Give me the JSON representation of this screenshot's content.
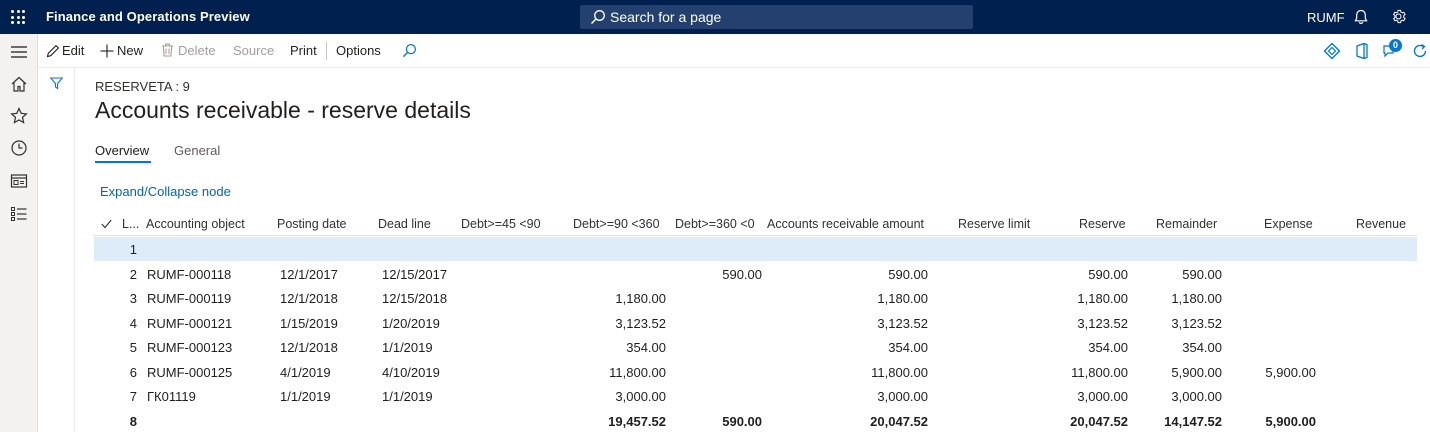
{
  "app": {
    "title": "Finance and Operations Preview",
    "company": "RUMF"
  },
  "search": {
    "placeholder": "Search for a page"
  },
  "actions": {
    "edit": "Edit",
    "new": "New",
    "delete": "Delete",
    "source": "Source",
    "print": "Print",
    "options": "Options",
    "badge_count": "0"
  },
  "page": {
    "record_id": "RESERVETA : 9",
    "title": "Accounts receivable - reserve details"
  },
  "tabs": [
    "Overview",
    "General"
  ],
  "expand_link": "Expand/Collapse node",
  "grid": {
    "headers": [
      "L...",
      "Accounting object",
      "Posting date",
      "Dead line",
      "Debt>=45 <90",
      "Debt>=90 <360",
      "Debt>=360 <0",
      "Accounts receivable amount",
      "Reserve limit",
      "Reserve",
      "Remainder",
      "Expense",
      "Revenue"
    ],
    "rows": [
      [
        "1",
        "",
        "",
        "",
        "",
        "",
        "",
        "",
        "",
        "",
        "",
        "",
        ""
      ],
      [
        "2",
        "RUMF-000118",
        "12/1/2017",
        "12/15/2017",
        "",
        "",
        "590.00",
        "590.00",
        "",
        "590.00",
        "590.00",
        "",
        ""
      ],
      [
        "3",
        "RUMF-000119",
        "12/1/2018",
        "12/15/2018",
        "",
        "1,180.00",
        "",
        "1,180.00",
        "",
        "1,180.00",
        "1,180.00",
        "",
        ""
      ],
      [
        "4",
        "RUMF-000121",
        "1/15/2019",
        "1/20/2019",
        "",
        "3,123.52",
        "",
        "3,123.52",
        "",
        "3,123.52",
        "3,123.52",
        "",
        ""
      ],
      [
        "5",
        "RUMF-000123",
        "12/1/2018",
        "1/1/2019",
        "",
        "354.00",
        "",
        "354.00",
        "",
        "354.00",
        "354.00",
        "",
        ""
      ],
      [
        "6",
        "RUMF-000125",
        "4/1/2019",
        "4/10/2019",
        "",
        "11,800.00",
        "",
        "11,800.00",
        "",
        "11,800.00",
        "5,900.00",
        "5,900.00",
        ""
      ],
      [
        "7",
        "ГК01119",
        "1/1/2019",
        "1/1/2019",
        "",
        "3,000.00",
        "",
        "3,000.00",
        "",
        "3,000.00",
        "3,000.00",
        "",
        ""
      ],
      [
        "8",
        "",
        "",
        "",
        "",
        "19,457.52",
        "590.00",
        "20,047.52",
        "",
        "20,047.52",
        "14,147.52",
        "5,900.00",
        ""
      ]
    ]
  }
}
